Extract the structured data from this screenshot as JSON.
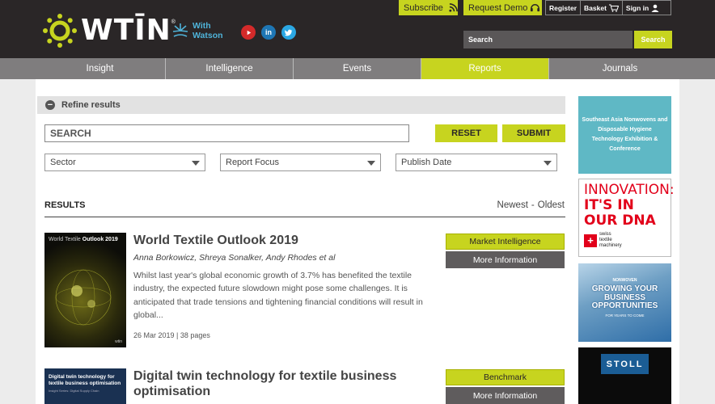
{
  "header": {
    "logo_text": "WTĪN",
    "logo_reg": "®",
    "watson_text_line1": "With",
    "watson_text_line2": "Watson",
    "subscribe_label": "Subscribe",
    "request_demo_label": "Request Demo",
    "register_label": "Register",
    "basket_label": "Basket",
    "sign_in_label": "Sign in",
    "search_placeholder": "Search",
    "search_button_label": "Search",
    "social": [
      "youtube",
      "linkedin",
      "twitter"
    ]
  },
  "nav": {
    "items": [
      {
        "label": "Insight"
      },
      {
        "label": "Intelligence"
      },
      {
        "label": "Events"
      },
      {
        "label": "Reports"
      },
      {
        "label": "Journals"
      }
    ],
    "active": "Reports"
  },
  "refine": {
    "title": "Refine results",
    "search_placeholder": "SEARCH",
    "reset_label": "RESET",
    "submit_label": "SUBMIT",
    "filters": [
      {
        "label": "Sector"
      },
      {
        "label": "Report Focus"
      },
      {
        "label": "Publish Date"
      }
    ]
  },
  "results": {
    "label": "RESULTS",
    "sort_newest": "Newest",
    "sort_sep": "-",
    "sort_oldest": "Oldest",
    "items": [
      {
        "thumb_title_pre": "World Textile",
        "thumb_title_bold": "Outlook 2019",
        "thumb_brand": "wtin",
        "title": "World Textile Outlook 2019",
        "authors": "Anna Borkowicz, Shreya Sonalker, Andy Rhodes et al",
        "description": "Whilst last year's global economic growth of 3.7% has benefited the textile industry, the expected future slowdown might pose some challenges. It is anticipated that trade tensions and tightening financial conditions will result in global...",
        "meta": "26 Mar 2019 | 38 pages",
        "tag": "Market Intelligence",
        "more_label": "More Information"
      },
      {
        "thumb_title": "Digital twin technology for textile business optimisation",
        "thumb_sub": "Insight Series: Digital Supply Chain",
        "title": "Digital twin technology for textile business optimisation",
        "tag": "Benchmark",
        "more_label": "More Information"
      }
    ]
  },
  "ads": {
    "ad1_text": "Southeast Asia Nonwovens and Disposable Hygiene Technology Exhibition & Conference",
    "ad2_line1": "INNOVATION:",
    "ad2_line2": "IT'S IN",
    "ad2_line3": "OUR DNA",
    "ad2_brand_line1": "swiss",
    "ad2_brand_line2": "textile",
    "ad2_brand_line3": "machinery",
    "ad3_small": "NONWOVEN",
    "ad3_head": "GROWING YOUR BUSINESS OPPORTUNITIES",
    "ad3_foot": "FOR YEARS TO COME",
    "ad4_brand": "STOLL"
  },
  "colors": {
    "accent": "#c7d41f",
    "header_bg": "#2a2627",
    "nav_bg": "#7f7d7e",
    "button_dark": "#5f5c5d"
  }
}
